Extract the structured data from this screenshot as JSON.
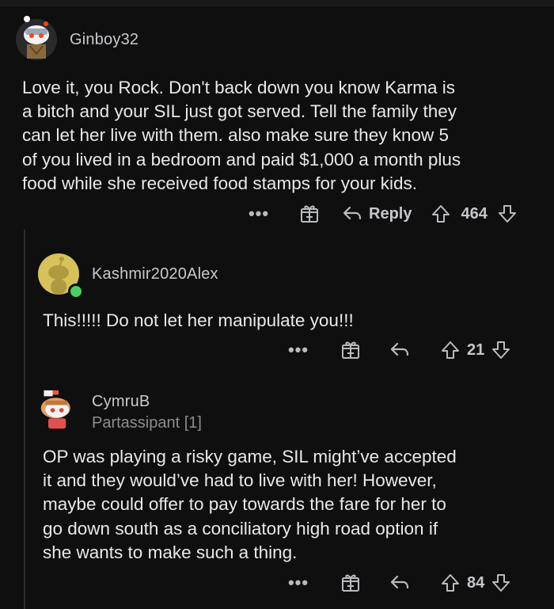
{
  "comments": [
    {
      "username": "Ginboy32",
      "flair": "",
      "body_lines": [
        "Love it, you Rock. Don't back down you know Karma is",
        "a bitch and your SIL just got served. Tell the family they",
        "can let her live with them. also make sure they know 5",
        "of you lived in a bedroom and paid $1,000 a month plus",
        "food while she received food stamps for your kids."
      ],
      "more_label": "•••",
      "reply_label": "Reply",
      "votes": "464"
    },
    {
      "username": "Kashmir2020Alex",
      "flair": "",
      "body_lines": [
        "This!!!!! Do not let her manipulate you!!!"
      ],
      "more_label": "•••",
      "votes": "21"
    },
    {
      "username": "CymruB",
      "flair": "Partassipant [1]",
      "body_lines": [
        "OP was playing a risky game, SIL might’ve accepted",
        "it and they would’ve had to live with her! However,",
        "maybe could offer to pay towards the fare for her to",
        "go down south as a conciliatory high road option if",
        "she wants to make such a thing."
      ],
      "more_label": "•••",
      "votes": "84"
    }
  ],
  "colors": {
    "background": "#0f0f10",
    "text": "#e8e9eb",
    "muted": "#8b8d90",
    "thread_line": "#2d2d2f",
    "online": "#46d160",
    "avatar_yellow": "#d6c15a"
  },
  "icons": [
    "avatar-snoo-icon",
    "award-icon",
    "reply-icon",
    "upvote-icon",
    "downvote-icon",
    "more-options-icon",
    "online-status-icon"
  ]
}
